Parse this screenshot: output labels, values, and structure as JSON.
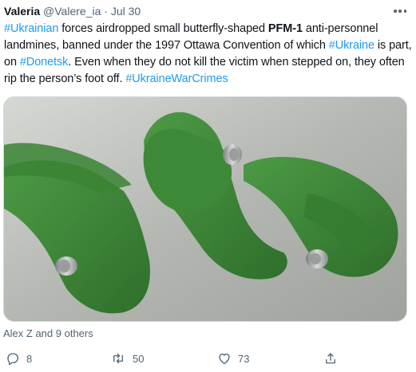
{
  "tweet": {
    "author_name": "Valeria",
    "author_handle": "@Valere_ia",
    "separator": "·",
    "date": "Jul 30",
    "text_parts": {
      "p1_tag": "#Ukrainian",
      "p2": " forces airdropped small butterfly-shaped ",
      "p3_bold": "PFM-1",
      "p4": " anti-personnel landmines, banned under the 1997 Ottawa Convention of which ",
      "p5_tag": "#Ukraine",
      "p6": " is part, on ",
      "p7_tag": "#Donetsk",
      "p8": ". Even when they do not kill the victim when stepped on, they often rip the person’s foot off. ",
      "p9_tag": "#UkraineWarCrimes"
    },
    "liked_by": "Alex Z and 9 others"
  },
  "actions": {
    "reply_count": "8",
    "retweet_count": "50",
    "like_count": "73"
  },
  "colors": {
    "link": "#1d9bf0",
    "muted": "#536471",
    "mine_green": "#3f8a3a"
  },
  "icons": [
    "more-icon",
    "reply-icon",
    "retweet-icon",
    "like-icon",
    "share-icon"
  ]
}
